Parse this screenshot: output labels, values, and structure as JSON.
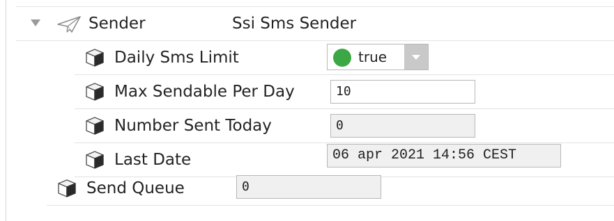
{
  "sender": {
    "label": "Sender",
    "type": "Ssi Sms Sender",
    "icon": "paper-plane-icon",
    "expanded": true
  },
  "properties": [
    {
      "label": "Daily Sms Limit",
      "value": "true",
      "kind": "dropdown",
      "status_color": "#3ba845",
      "icon": "cube-icon"
    },
    {
      "label": "Max Sendable Per Day",
      "value": "10",
      "kind": "editable",
      "icon": "cube-icon"
    },
    {
      "label": "Number Sent Today",
      "value": "0",
      "kind": "readonly",
      "icon": "cube-icon"
    },
    {
      "label": "Last Date",
      "value": "06 apr 2021 14:56 CEST",
      "kind": "readonly",
      "icon": "cube-icon"
    }
  ],
  "send_queue": {
    "label": "Send Queue",
    "value": "0",
    "icon": "cube-icon"
  }
}
